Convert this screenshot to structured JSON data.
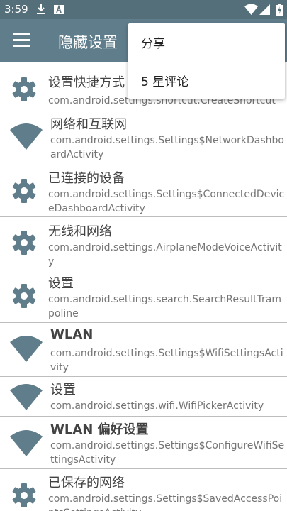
{
  "status": {
    "time": "3:59"
  },
  "appbar": {
    "title": "隐藏设置"
  },
  "menu": {
    "items": [
      "分享",
      "5 星评论"
    ]
  },
  "list": [
    {
      "icon": "gear-icon",
      "title": "设置快捷方式",
      "subtitle": "com.android.settings.shortcut.CreateShortcut"
    },
    {
      "icon": "wifi-icon",
      "title": "网络和互联网",
      "subtitle": "com.android.settings.Settings$NetworkDashboardActivity"
    },
    {
      "icon": "gear-icon",
      "title": "已连接的设备",
      "subtitle": "com.android.settings.Settings$ConnectedDeviceDashboardActivity"
    },
    {
      "icon": "gear-icon",
      "title": "无线和网络",
      "subtitle": "com.android.settings.AirplaneModeVoiceActivity"
    },
    {
      "icon": "gear-icon",
      "title": "设置",
      "subtitle": "com.android.settings.search.SearchResultTrampoline"
    },
    {
      "icon": "wifi-icon",
      "title": "WLAN",
      "subtitle": "com.android.settings.Settings$WifiSettingsActivity"
    },
    {
      "icon": "wifi-icon",
      "title": "设置",
      "subtitle": "com.android.settings.wifi.WifiPickerActivity"
    },
    {
      "icon": "wifi-icon",
      "title": "WLAN 偏好设置",
      "subtitle": "com.android.settings.Settings$ConfigureWifiSettingsActivity"
    },
    {
      "icon": "gear-icon",
      "title": "已保存的网络",
      "subtitle": "com.android.settings.Settings$SavedAccessPointsSettingsActivity"
    }
  ]
}
